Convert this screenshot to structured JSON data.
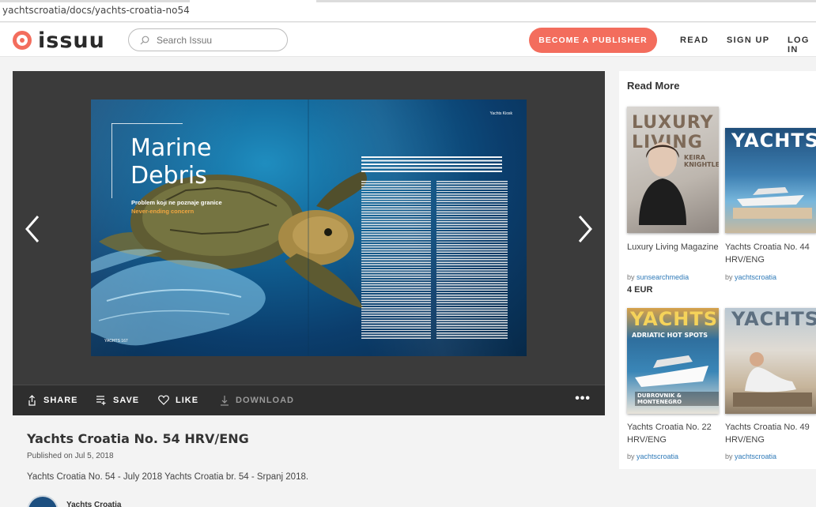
{
  "browser": {
    "url": "yachtscroatia/docs/yachts-croatia-no54"
  },
  "header": {
    "logo_text": "issuu",
    "search_placeholder": "Search Issuu",
    "publisher_button": "BECOME A PUBLISHER",
    "nav": [
      "READ",
      "SIGN UP",
      "LOG IN"
    ],
    "brand_color": "#f36d5d"
  },
  "spread": {
    "title_line1": "Marine",
    "title_line2": "Debris",
    "subtitle_hr": "Problem koji ne poznaje granice",
    "subtitle_en": "Never-ending concern",
    "corner_label": "Yachts Kiosk",
    "page_label": "YACHTS 167"
  },
  "toolbar": {
    "share": "SHARE",
    "save": "SAVE",
    "like": "LIKE",
    "download": "DOWNLOAD",
    "more": "•••"
  },
  "document": {
    "title": "Yachts Croatia No. 54 HRV/ENG",
    "published": "Published on Jul 5, 2018",
    "description": "Yachts Croatia No. 54 - July 2018 Yachts Croatia br. 54 - Srpanj 2018.",
    "publisher": "Yachts Croatia"
  },
  "read_more": {
    "heading": "Read More",
    "by_prefix": "by",
    "items": [
      {
        "name": "Luxury Living Magazine",
        "publisher": "sunsearchmedia",
        "price": "4 EUR",
        "cover_title": "LUXURY LIVING",
        "cover_sub": "KEIRA KNIGHTLEY"
      },
      {
        "name": "Yachts Croatia No. 44 HRV/ENG",
        "publisher": "yachtscroatia",
        "price": "",
        "cover_title": "YACHTS"
      },
      {
        "name": "Yachts Croatia No. 22 HRV/ENG",
        "publisher": "yachtscroatia",
        "price": "",
        "cover_title": "YACHTS",
        "cover_sub": "ADRIATIC HOT SPOTS",
        "cover_sub2": "DUBROVNIK & MONTENEGRO"
      },
      {
        "name": "Yachts Croatia No. 49 HRV/ENG",
        "publisher": "yachtscroatia",
        "price": "",
        "cover_title": "YACHTS"
      }
    ]
  }
}
